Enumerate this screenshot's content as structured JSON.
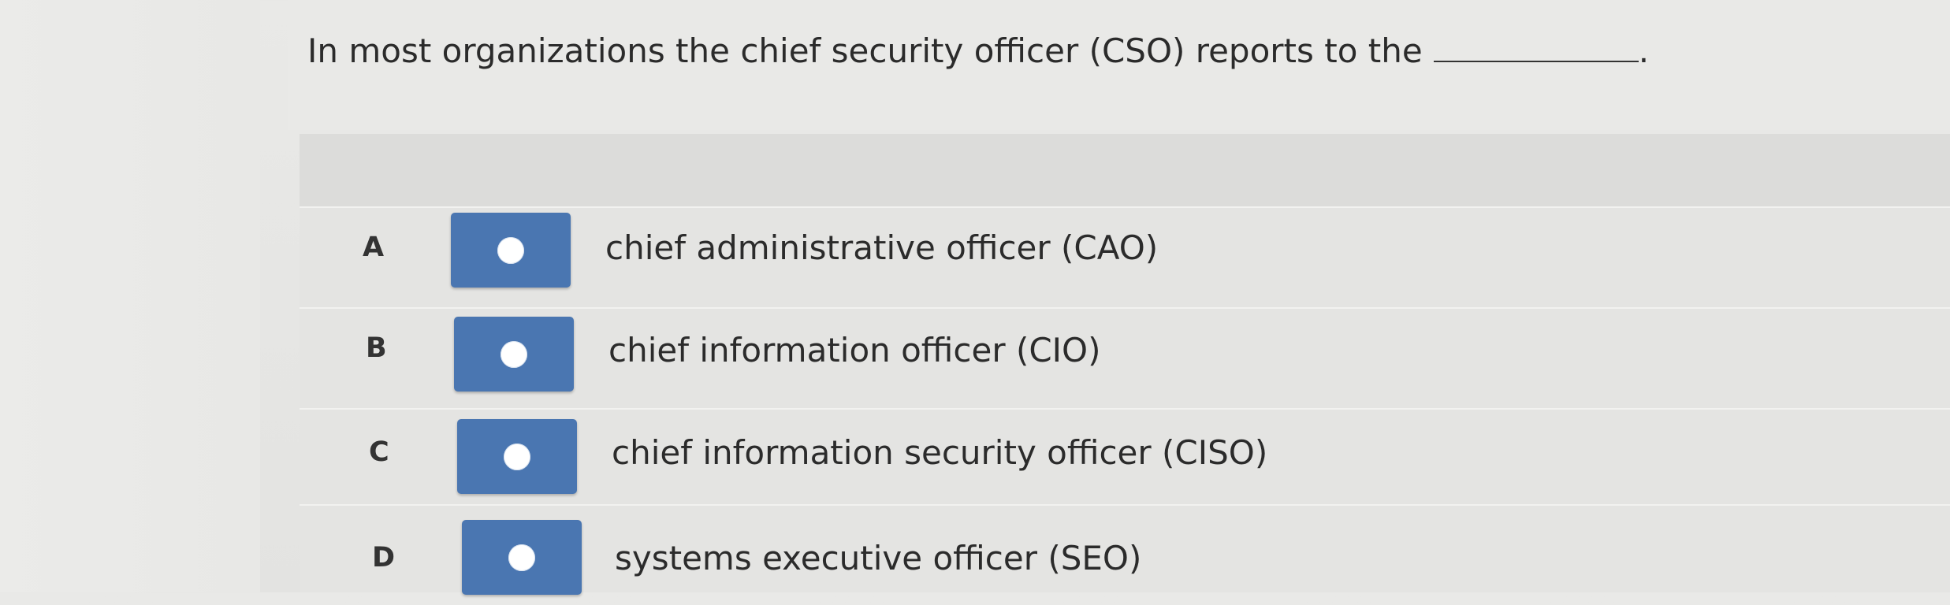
{
  "question": {
    "text": "In most organizations the chief security officer (CSO) reports to the",
    "trailing_punctuation": "."
  },
  "options": [
    {
      "letter": "A",
      "text": "chief administrative officer (CAO)"
    },
    {
      "letter": "B",
      "text": "chief information officer (CIO)"
    },
    {
      "letter": "C",
      "text": "chief information security officer (CISO)"
    },
    {
      "letter": "D",
      "text": "systems executive officer (SEO)"
    }
  ],
  "colors": {
    "radio_box": "#4a76b1",
    "radio_dot": "#ffffff",
    "background": "#e7e7e5"
  }
}
